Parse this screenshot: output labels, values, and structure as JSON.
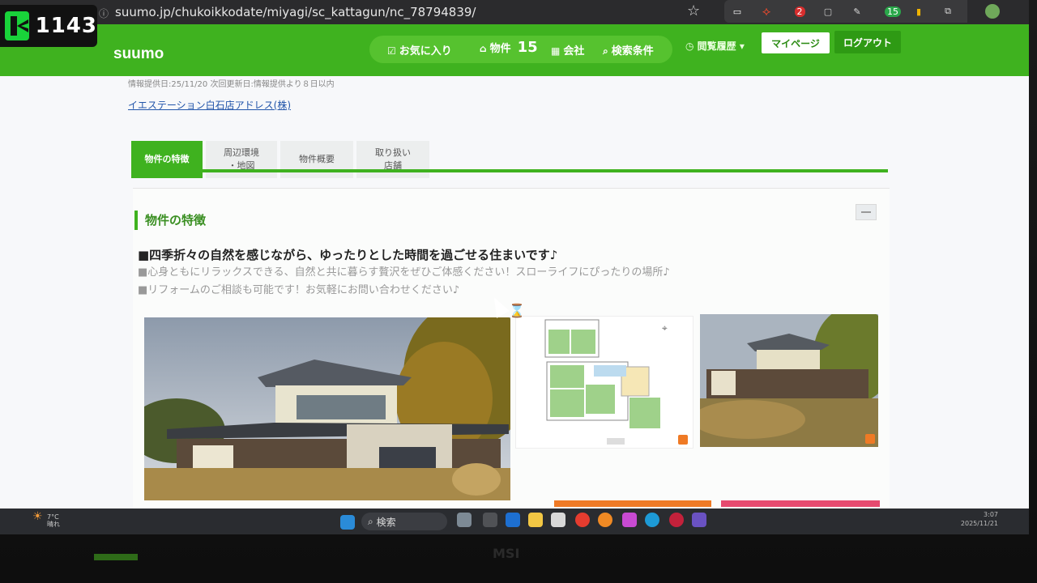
{
  "overlay": {
    "counter": "1143"
  },
  "browser": {
    "url": "suumo.jp/chukoikkodate/miyagi/sc_kattagun/nc_78794839/",
    "extension_badges": [
      "2",
      "15"
    ]
  },
  "header": {
    "logo": "suumo",
    "nav": {
      "favorites": "お気に入り",
      "properties": "物件",
      "properties_count": "15",
      "companies": "会社",
      "search_conditions": "検索条件"
    },
    "history": "閲覧履歴",
    "mypage": "マイページ",
    "logout": "ログアウト"
  },
  "info_line": "情報提供日:25/11/20 次回更新日:情報提供より８日以内",
  "agency": "イエステーション白石店アドレス(株)",
  "tabs": [
    "物件の特徴",
    "周辺環境\n・地図",
    "物件概要",
    "取り扱い\n店舗"
  ],
  "section": {
    "title": "物件の特徴",
    "headline": "■四季折々の自然を感じながら、ゆったりとした時間を過ごせる住まいです♪",
    "lines": [
      "■心身ともにリラックスできる、自然と共に暮らす贅沢をぜひご体感ください！スローライフにぴったりの場所♪",
      "■リフォームのご相談も可能です！お気軽にお問い合わせください♪"
    ]
  },
  "taskbar": {
    "weather_temp": "7°C",
    "weather_text": "晴れ",
    "search": "検索",
    "time": "3:07",
    "date": "2025/11/21"
  },
  "monitor_brand": "MSI",
  "colors": {
    "brand_green": "#3fb21f",
    "link_blue": "#2255aa"
  }
}
